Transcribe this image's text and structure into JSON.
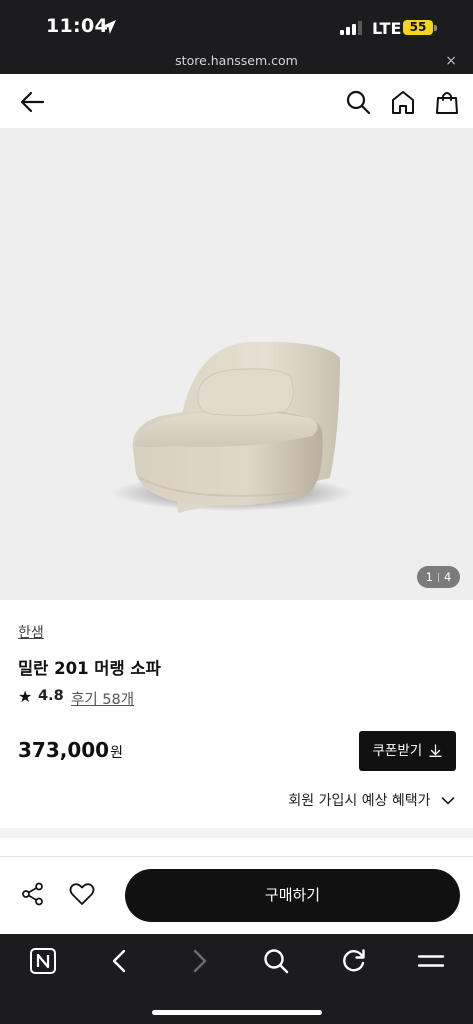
{
  "status_bar": {
    "time": "11:04",
    "network": "LTE",
    "battery": "55"
  },
  "url_bar": {
    "domain": "store.hanssem.com",
    "close_label": "×"
  },
  "header": {
    "back_icon": "arrow-left-icon",
    "search_icon": "search-icon",
    "home_icon": "home-icon",
    "cart_icon": "shopping-bag-icon"
  },
  "gallery": {
    "current_page": "1",
    "total_pages": "4",
    "image": "beige-boucle-swivel-chair"
  },
  "product": {
    "brand": "한샘",
    "name": "밀란 201 머랭 소파",
    "rating": "4.8",
    "reviews_label": "후기 58개",
    "price": "373,000",
    "price_unit": "원",
    "coupon_label": "쿠폰받기",
    "benefit_label": "회원 가입시 예상 혜택가"
  },
  "bottom_bar": {
    "share_icon": "share-icon",
    "wishlist_icon": "heart-icon",
    "buy_label": "구매하기"
  },
  "browser_toolbar": [
    "naver-n-icon",
    "chevron-left-icon",
    "chevron-right-icon",
    "search-icon",
    "reload-icon",
    "menu-icon"
  ],
  "colors": {
    "accent": "#111111",
    "gallery_bg": "#eeeeee",
    "battery": "#f7d41b"
  }
}
